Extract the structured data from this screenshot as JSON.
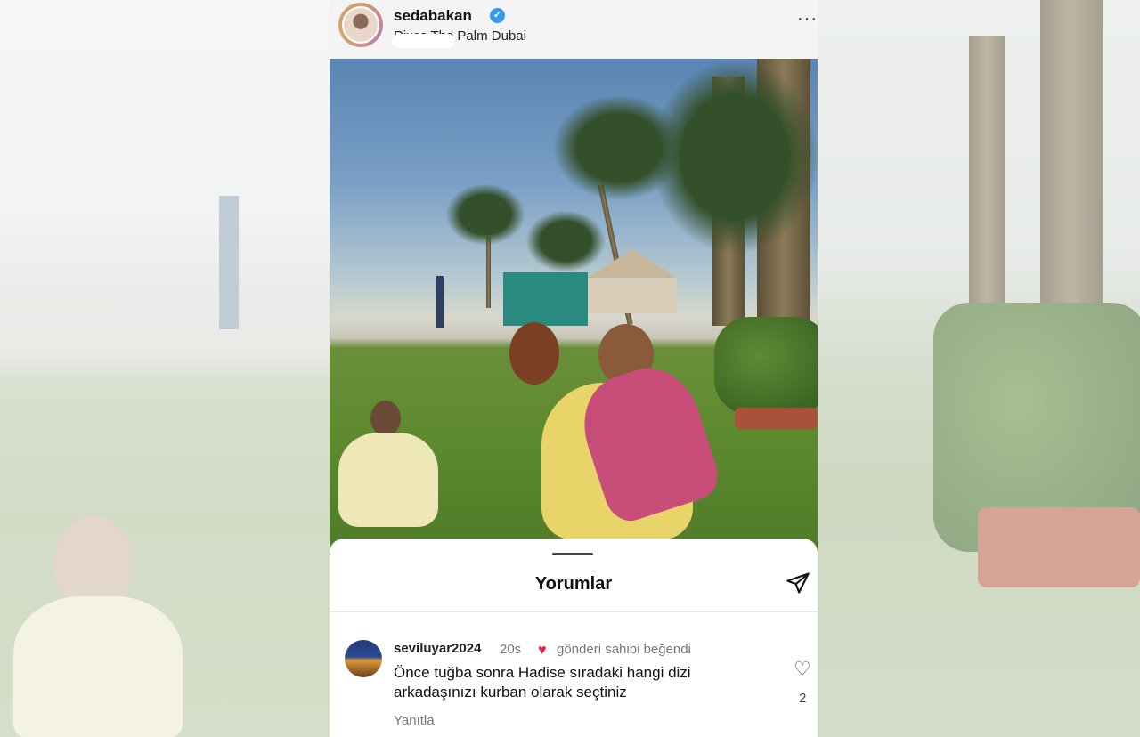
{
  "post": {
    "username": "sedabakan",
    "location": "Rixos The Palm Dubai",
    "more_label": "···"
  },
  "comments_sheet": {
    "title": "Yorumlar"
  },
  "comment": {
    "user": "seviluyar2024",
    "time": "20s",
    "liked_label": "gönderi sahibi beğendi",
    "text": "Önce tuğba sonra Hadise sıradaki hangi dizi arkadaşınızı kurban olarak seçtiniz",
    "reply_label": "Yanıtla",
    "like_count": "2"
  },
  "icons": {
    "verified": "verified-badge-icon",
    "send": "send-icon",
    "heart": "heart-icon",
    "more": "more-options-icon"
  },
  "colors": {
    "verified": "#3897f0",
    "heart": "#e6233d"
  }
}
